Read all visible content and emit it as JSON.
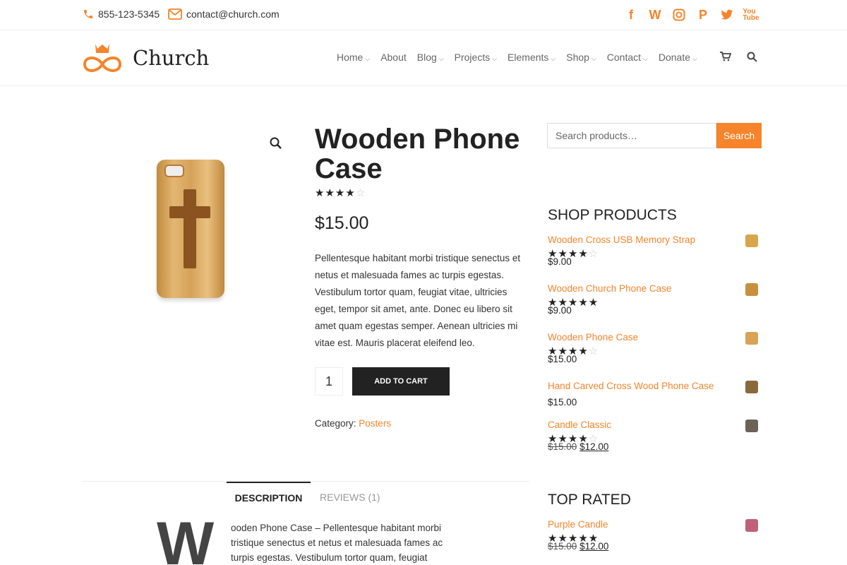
{
  "topbar": {
    "phone": "855-123-5345",
    "email": "contact@church.com",
    "social": [
      "facebook-icon",
      "w-icon",
      "instagram-icon",
      "paypal-icon",
      "twitter-icon",
      "youtube-icon"
    ]
  },
  "header": {
    "brand": "Church",
    "nav": [
      {
        "label": "Home",
        "has_menu": true
      },
      {
        "label": "About",
        "has_menu": false
      },
      {
        "label": "Blog",
        "has_menu": true
      },
      {
        "label": "Projects",
        "has_menu": true
      },
      {
        "label": "Elements",
        "has_menu": true
      },
      {
        "label": "Shop",
        "has_menu": true
      },
      {
        "label": "Contact",
        "has_menu": true
      },
      {
        "label": "Donate",
        "has_menu": true
      }
    ]
  },
  "product": {
    "title": "Wooden Phone Case",
    "rating": 4,
    "price": "$15.00",
    "description": "Pellentesque habitant morbi tristique senectus et netus et malesuada fames ac turpis egestas. Vestibulum tortor quam, feugiat vitae, ultricies eget, tempor sit amet, ante. Donec eu libero sit amet quam egestas semper. Aenean ultricies mi vitae est. Mauris placerat eleifend leo.",
    "quantity": "1",
    "add_to_cart": "ADD TO CART",
    "category_label": "Category:",
    "category": "Posters"
  },
  "tabs": {
    "description": "DESCRIPTION",
    "reviews": "REVIEWS (1)",
    "dropcap": "W",
    "body": "ooden Phone Case – Pellentesque habitant morbi tristique senectus et netus et malesuada fames ac turpis egestas. Vestibulum tortor quam, feugiat"
  },
  "sidebar": {
    "search_placeholder": "Search products…",
    "search_button": "Search",
    "shop_title": "SHOP PRODUCTS",
    "shop_products": [
      {
        "name": "Wooden Cross USB Memory Strap",
        "rating": 4,
        "price": "$9.00",
        "old_price": ""
      },
      {
        "name": "Wooden Church Phone Case",
        "rating": 5,
        "price": "$9.00",
        "old_price": ""
      },
      {
        "name": "Wooden Phone Case",
        "rating": 4,
        "price": "$15.00",
        "old_price": ""
      },
      {
        "name": "Hand Carved Cross Wood Phone Case",
        "rating": 0,
        "price": "$15.00",
        "old_price": ""
      },
      {
        "name": "Candle Classic",
        "rating": 4,
        "price": "$12.00",
        "old_price": "$15.00"
      }
    ],
    "top_title": "TOP RATED",
    "top_products": [
      {
        "name": "Purple Candle",
        "rating": 5,
        "price": "$12.00",
        "old_price": "$15.00"
      }
    ]
  },
  "colors": {
    "accent": "#f5842b",
    "dark": "#222222"
  }
}
